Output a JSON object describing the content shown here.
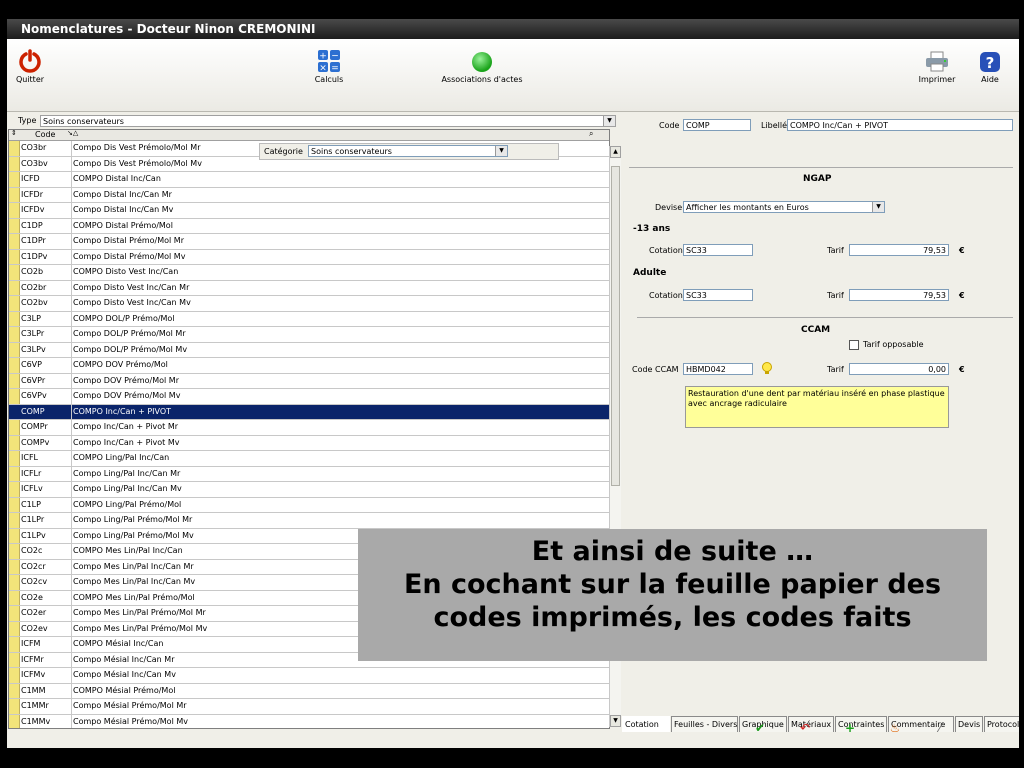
{
  "window": {
    "title": "Nomenclatures - Docteur Ninon CREMONINI"
  },
  "toolbar": {
    "quit_label": "Quitter",
    "calc_label": "Calculs",
    "assoc_label": "Associations d'actes",
    "print_label": "Imprimer",
    "help_label": "Aide"
  },
  "filter": {
    "type_label": "Type",
    "type_value": "Soins conservateurs",
    "category_label": "Catégorie",
    "category_value": "Soins conservateurs"
  },
  "grid": {
    "code_header": "Code",
    "rows": [
      {
        "code": "CO3br",
        "libelle": "Compo Dis Vest Prémolo/Mol Mr"
      },
      {
        "code": "CO3bv",
        "libelle": "Compo Dis Vest Prémolo/Mol Mv"
      },
      {
        "code": "ICFD",
        "libelle": "COMPO Distal Inc/Can"
      },
      {
        "code": "ICFDr",
        "libelle": "Compo Distal Inc/Can Mr"
      },
      {
        "code": "ICFDv",
        "libelle": "Compo Distal Inc/Can Mv"
      },
      {
        "code": "C1DP",
        "libelle": "COMPO Distal Prémo/Mol"
      },
      {
        "code": "C1DPr",
        "libelle": "Compo Distal Prémo/Mol Mr"
      },
      {
        "code": "C1DPv",
        "libelle": "Compo Distal Prémo/Mol Mv"
      },
      {
        "code": "CO2b",
        "libelle": "COMPO Disto Vest Inc/Can"
      },
      {
        "code": "CO2br",
        "libelle": "Compo Disto Vest Inc/Can Mr"
      },
      {
        "code": "CO2bv",
        "libelle": "Compo Disto Vest Inc/Can Mv"
      },
      {
        "code": "C3LP",
        "libelle": "COMPO DOL/P Prémo/Mol"
      },
      {
        "code": "C3LPr",
        "libelle": "Compo DOL/P Prémo/Mol Mr"
      },
      {
        "code": "C3LPv",
        "libelle": "Compo DOL/P Prémo/Mol Mv"
      },
      {
        "code": "C6VP",
        "libelle": "COMPO DOV Prémo/Mol"
      },
      {
        "code": "C6VPr",
        "libelle": "Compo DOV Prémo/Mol Mr"
      },
      {
        "code": "C6VPv",
        "libelle": "Compo DOV Prémo/Mol Mv"
      },
      {
        "code": "COMP",
        "libelle": "COMPO Inc/Can + PIVOT"
      },
      {
        "code": "COMPr",
        "libelle": "Compo Inc/Can + Pivot Mr"
      },
      {
        "code": "COMPv",
        "libelle": "Compo Inc/Can + Pivot Mv"
      },
      {
        "code": "ICFL",
        "libelle": "COMPO Ling/Pal Inc/Can"
      },
      {
        "code": "ICFLr",
        "libelle": "Compo Ling/Pal Inc/Can Mr"
      },
      {
        "code": "ICFLv",
        "libelle": "Compo Ling/Pal Inc/Can Mv"
      },
      {
        "code": "C1LP",
        "libelle": "COMPO Ling/Pal Prémo/Mol"
      },
      {
        "code": "C1LPr",
        "libelle": "Compo Ling/Pal Prémo/Mol Mr"
      },
      {
        "code": "C1LPv",
        "libelle": "Compo Ling/Pal Prémo/Mol Mv"
      },
      {
        "code": "CO2c",
        "libelle": "COMPO Mes Lin/Pal Inc/Can"
      },
      {
        "code": "CO2cr",
        "libelle": "Compo Mes Lin/Pal Inc/Can Mr"
      },
      {
        "code": "CO2cv",
        "libelle": "Compo Mes Lin/Pal Inc/Can Mv"
      },
      {
        "code": "CO2e",
        "libelle": "COMPO Mes Lin/Pal Prémo/Mol"
      },
      {
        "code": "CO2er",
        "libelle": "Compo Mes Lin/Pal Prémo/Mol Mr"
      },
      {
        "code": "CO2ev",
        "libelle": "Compo Mes Lin/Pal Prémo/Mol Mv"
      },
      {
        "code": "ICFM",
        "libelle": "COMPO Mésial Inc/Can"
      },
      {
        "code": "ICFMr",
        "libelle": "Compo Mésial Inc/Can Mr"
      },
      {
        "code": "ICFMv",
        "libelle": "Compo Mésial Inc/Can Mv"
      },
      {
        "code": "C1MM",
        "libelle": "COMPO Mésial Prémo/Mol"
      },
      {
        "code": "C1MMr",
        "libelle": "Compo Mésial Prémo/Mol Mr"
      },
      {
        "code": "C1MMv",
        "libelle": "Compo Mésial Prémo/Mol Mv"
      }
    ],
    "selected_code": "COMP"
  },
  "detail": {
    "code_label": "Code",
    "code_value": "COMP",
    "libelle_label": "Libellé",
    "libelle_value": "COMPO Inc/Can + PIVOT",
    "ngap_title": "NGAP",
    "devise_label": "Devise",
    "devise_value": "Afficher les montants en Euros",
    "child_section": "-13 ans",
    "adult_section": "Adulte",
    "cotation_label": "Cotation",
    "child_cotation": "SC33",
    "adult_cotation": "SC33",
    "tarif_label": "Tarif",
    "child_tarif": "79,53",
    "adult_tarif": "79,53",
    "currency": "€",
    "ccam_title": "CCAM",
    "tarif_opposable_label": "Tarif opposable",
    "code_ccam_label": "Code CCAM",
    "code_ccam_value": "HBMD042",
    "ccam_tarif": "0,00",
    "ccam_description": "Restauration d'une dent par matériau inséré en phase plastique avec ancrage radiculaire"
  },
  "tabs": [
    "Cotation",
    "Feuilles - Divers",
    "Graphique",
    "Matériaux",
    "Contraintes",
    "Commentaire",
    "Devis",
    "Protocole"
  ],
  "overlay": {
    "line1": "Et ainsi de suite …",
    "line2": "En cochant sur la feuille papier des",
    "line3": "codes imprimés, les codes faits"
  }
}
